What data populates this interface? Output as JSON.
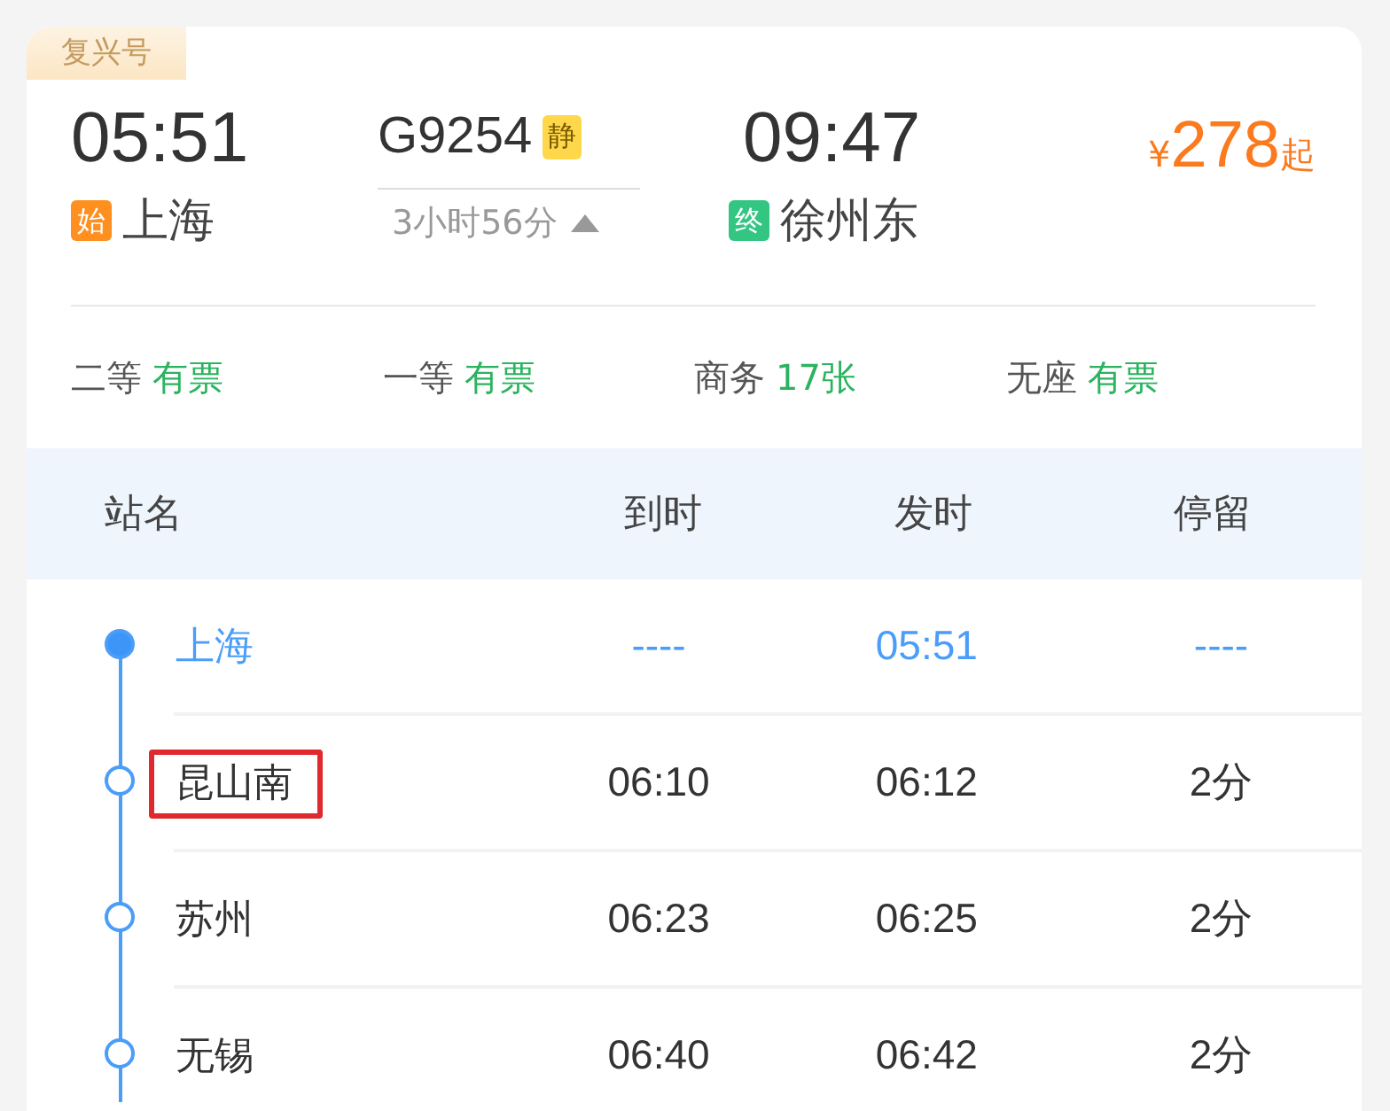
{
  "train_type": "复兴号",
  "departure": {
    "time": "05:51",
    "tag": "始",
    "station": "上海"
  },
  "train": {
    "number": "G9254",
    "badge": "静",
    "duration": "3小时56分",
    "expanded": true
  },
  "arrival": {
    "time": "09:47",
    "tag": "终",
    "station": "徐州东"
  },
  "price": {
    "currency": "¥",
    "amount": "278",
    "suffix": "起"
  },
  "seats": [
    {
      "class": "二等",
      "availability": "有票"
    },
    {
      "class": "一等",
      "availability": "有票"
    },
    {
      "class": "商务",
      "availability": "17张"
    },
    {
      "class": "无座",
      "availability": "有票"
    }
  ],
  "table": {
    "columns": [
      "站名",
      "到时",
      "发时",
      "停留"
    ],
    "rows": [
      {
        "station": "上海",
        "arrive": "----",
        "depart": "05:51",
        "stay": "----",
        "current": true,
        "highlighted": false
      },
      {
        "station": "昆山南",
        "arrive": "06:10",
        "depart": "06:12",
        "stay": "2分",
        "current": false,
        "highlighted": true
      },
      {
        "station": "苏州",
        "arrive": "06:23",
        "depart": "06:25",
        "stay": "2分",
        "current": false,
        "highlighted": false
      },
      {
        "station": "无锡",
        "arrive": "06:40",
        "depart": "06:42",
        "stay": "2分",
        "current": false,
        "highlighted": false
      }
    ]
  }
}
